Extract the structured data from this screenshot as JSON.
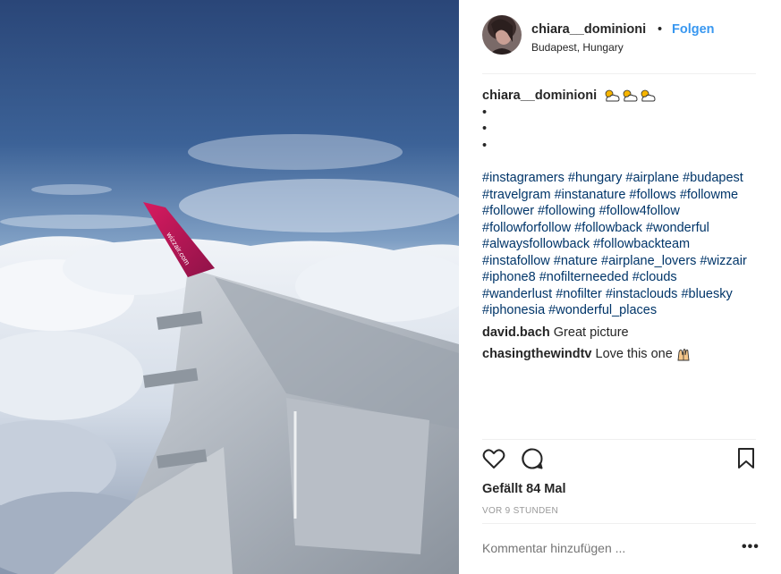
{
  "post": {
    "photo_alt": "wizzair.com",
    "header": {
      "username": "chiara__dominioni",
      "separator": "•",
      "follow_label": "Folgen",
      "location": "Budapest, Hungary"
    },
    "caption": {
      "username": "chiara__dominioni",
      "emoji": [
        "sun-behind-cloud-icon",
        "sun-behind-cloud-icon",
        "sun-behind-cloud-icon"
      ],
      "bullets": [
        "•",
        "•",
        "•"
      ],
      "hashtag_lines": [
        "#instagramers #hungary #airplane #budapest",
        "#travelgram #instanature #follows #followme",
        "#follower #following #follow4follow",
        "#followforfollow #followback #wonderful",
        "#alwaysfollowback #followbackteam",
        "#instafollow #nature #airplane_lovers #wizzair",
        "#iphone8 #nofilterneeded #clouds",
        "#wanderlust #nofilter #instaclouds #bluesky",
        "#iphonesia #wonderful_places"
      ]
    },
    "comments": [
      {
        "username": "david.bach",
        "text": "Great picture"
      },
      {
        "username": "chasingthewindtv",
        "text": "Love this one",
        "emoji": "raising-hands-icon"
      }
    ],
    "actions": {
      "like": "heart-icon",
      "comment": "comment-bubble-icon",
      "save": "bookmark-icon"
    },
    "likes": "Gefällt 84 Mal",
    "timestamp": "VOR 9 STUNDEN",
    "comment_input": {
      "placeholder": "Kommentar hinzufügen ...",
      "value": ""
    },
    "more_label": "•••"
  },
  "colors": {
    "link_blue": "#3897f0",
    "hashtag": "#003569",
    "text": "#262626",
    "muted": "#999999",
    "sky_top": "#2b4a80",
    "wing_tip": "#c2185b"
  }
}
